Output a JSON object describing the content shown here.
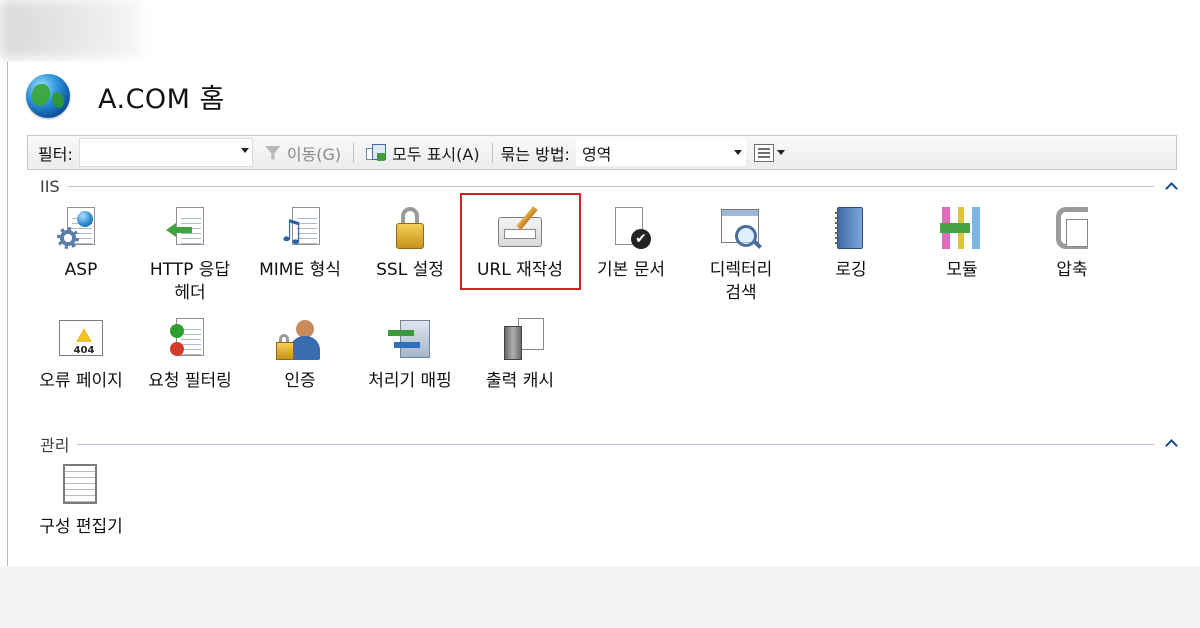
{
  "header": {
    "title": "A.COM 홈"
  },
  "toolbar": {
    "filter_label": "필터:",
    "filter_value": "",
    "go_label": "이동(G)",
    "show_all_label": "모두 표시(A)",
    "group_by_label": "묶는 방법:",
    "group_by_value": "영역"
  },
  "groups": {
    "iis": {
      "label": "IIS"
    },
    "management": {
      "label": "관리"
    }
  },
  "features": {
    "asp": "ASP",
    "http_headers": "HTTP 응답\n헤더",
    "mime": "MIME 형식",
    "ssl": "SSL 설정",
    "url_rewrite": "URL 재작성",
    "default_document": "기본 문서",
    "directory_browsing": "디렉터리\n검색",
    "logging": "로깅",
    "modules": "모듈",
    "compression": "압축",
    "error_pages": "오류 페이지",
    "request_filtering": "요청 필터링",
    "authentication": "인증",
    "handler_mappings": "처리기 매핑",
    "output_caching": "출력 캐시",
    "config_editor": "구성 편집기"
  },
  "colors": {
    "highlight": "#d32026",
    "group_line": "#b7c7dc"
  }
}
